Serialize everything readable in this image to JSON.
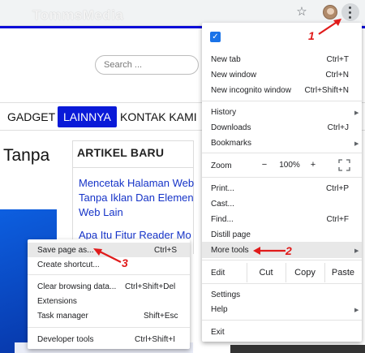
{
  "browser": {
    "star_icon": "star-icon",
    "watermark": "TommsMedia"
  },
  "site": {
    "search_placeholder": "Search ...",
    "nav": [
      "GADGET",
      "LAINNYA",
      "KONTAK KAMI"
    ],
    "post_title_fragment": "Tanpa",
    "artikel_heading": "ARTIKEL BARU",
    "artikel_lines": [
      "Mencetak Halaman Web",
      "Tanpa Iklan Dan Elemen",
      "Web Lain",
      "Apa Itu Fitur Reader Mo"
    ]
  },
  "menu": {
    "items": {
      "new_tab": {
        "label": "New tab",
        "shortcut": "Ctrl+T"
      },
      "new_window": {
        "label": "New window",
        "shortcut": "Ctrl+N"
      },
      "new_incognito": {
        "label": "New incognito window",
        "shortcut": "Ctrl+Shift+N"
      },
      "history": {
        "label": "History"
      },
      "downloads": {
        "label": "Downloads",
        "shortcut": "Ctrl+J"
      },
      "bookmarks": {
        "label": "Bookmarks"
      },
      "zoom": {
        "label": "Zoom",
        "minus": "−",
        "value": "100%",
        "plus": "+"
      },
      "print": {
        "label": "Print...",
        "shortcut": "Ctrl+P"
      },
      "cast": {
        "label": "Cast..."
      },
      "find": {
        "label": "Find...",
        "shortcut": "Ctrl+F"
      },
      "distill": {
        "label": "Distill page"
      },
      "more_tools": {
        "label": "More tools"
      },
      "edit": {
        "label": "Edit",
        "cut": "Cut",
        "copy": "Copy",
        "paste": "Paste"
      },
      "settings": {
        "label": "Settings"
      },
      "help": {
        "label": "Help"
      },
      "exit": {
        "label": "Exit"
      }
    }
  },
  "submenu": {
    "save_page": {
      "label": "Save page as...",
      "shortcut": "Ctrl+S"
    },
    "create_shortcut": {
      "label": "Create shortcut..."
    },
    "clear_browsing": {
      "label": "Clear browsing data...",
      "shortcut": "Ctrl+Shift+Del"
    },
    "extensions": {
      "label": "Extensions"
    },
    "task_manager": {
      "label": "Task manager",
      "shortcut": "Shift+Esc"
    },
    "developer_tools": {
      "label": "Developer tools",
      "shortcut": "Ctrl+Shift+I"
    }
  },
  "annotations": {
    "step1": "1",
    "step2": "2",
    "step3": "3",
    "color": "#e01b1b"
  },
  "colors": {
    "accent_blue": "#0a1ad8",
    "link_blue": "#1533c8",
    "chrome_blue": "#1a73e8"
  }
}
